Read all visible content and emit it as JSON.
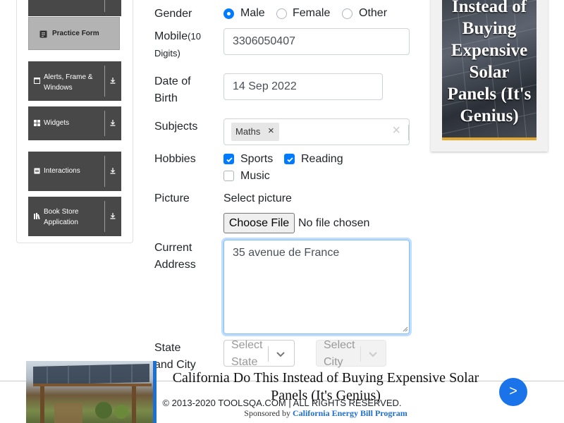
{
  "sidebar": {
    "practice_form": "Practice Form",
    "groups": [
      {
        "label": "Alerts, Frame & Windows"
      },
      {
        "label": "Widgets"
      },
      {
        "label": "Interactions"
      },
      {
        "label": "Book Store Application"
      }
    ]
  },
  "form": {
    "gender": {
      "label": "Gender",
      "options": [
        "Male",
        "Female",
        "Other"
      ],
      "selected": "Male"
    },
    "mobile": {
      "label": "Mobile",
      "hint": "(10 Digits)",
      "value": "3306050407"
    },
    "dob": {
      "label": "Date of Birth",
      "value": "14 Sep 2022"
    },
    "subjects": {
      "label": "Subjects",
      "tags": [
        "Maths"
      ],
      "clear_symbol": "×"
    },
    "hobbies": {
      "label": "Hobbies",
      "options": [
        {
          "label": "Sports",
          "checked": true
        },
        {
          "label": "Reading",
          "checked": true
        },
        {
          "label": "Music",
          "checked": false
        }
      ]
    },
    "picture": {
      "label": "Picture",
      "select_text": "Select picture",
      "button": "Choose File",
      "status": "No file chosen"
    },
    "address": {
      "label": "Current Address",
      "value": "35 avenue de France"
    },
    "state_city": {
      "label": "State and City",
      "state_placeholder": "Select State",
      "city_placeholder": "Select City"
    }
  },
  "ad_right": {
    "text": "Instead of Buying Expensive Solar Panels (It's Genius)"
  },
  "ad_bottom": {
    "title": "California Do This Instead of Buying Expensive Solar Panels (It's Genius)",
    "sponsored_prefix": "Sponsored by",
    "sponsor": "California Energy Bill Program",
    "next": ">"
  },
  "footer": {
    "text": "© 2013-2020 TOOLSQA.COM | ALL RIGHTS RESERVED."
  },
  "colors": {
    "accent": "#007bff",
    "sidebar_group": "#484848",
    "practice_bg": "#b3b3b3"
  }
}
